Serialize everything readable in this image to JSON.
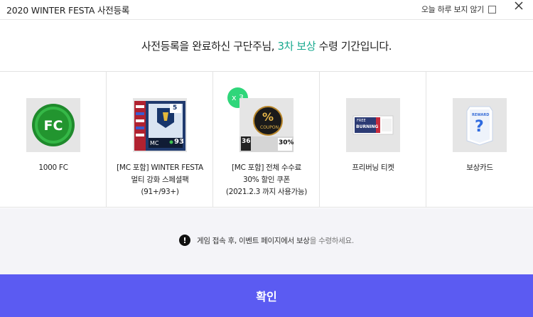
{
  "header": {
    "title": "2020 WINTER FESTA 사전등록",
    "dont_show_label": "오늘 하루 보지 않기"
  },
  "headline": {
    "prefix": "사전등록을 완료하신 구단주님, ",
    "accent": "3차 보상",
    "suffix": " 수령 기간입니다."
  },
  "rewards": [
    {
      "icon": "fc-coin-icon",
      "lines": [
        "1000 FC"
      ]
    },
    {
      "icon": "player-pack-icon",
      "lines": [
        "[MC 포함] WINTER FESTA",
        "멀티 강화 스페셜팩",
        "(91+/93+)"
      ],
      "thumb_text": {
        "level": "5",
        "ovr": "93",
        "pos": "MC"
      }
    },
    {
      "icon": "coupon-icon",
      "badge": "x 3",
      "lines": [
        "[MC 포함] 전체 수수료",
        "30% 할인 쿠폰",
        "(2021.2.3 까지 사용가능)"
      ],
      "thumb_text": {
        "sign": "%",
        "coupon": "COUPON",
        "days": "36",
        "percent": "30%"
      }
    },
    {
      "icon": "burning-ticket-icon",
      "lines": [
        "프리버닝 티켓"
      ],
      "thumb_text": {
        "free": "FREE",
        "burning": "BURNING"
      }
    },
    {
      "icon": "reward-card-icon",
      "lines": [
        "보상카드"
      ],
      "thumb_text": {
        "reward": "REWARD",
        "mark": "?"
      }
    }
  ],
  "notice": {
    "icon_glyph": "!",
    "text_main": "게임 접속 후, 이벤트 페이지에서 보상",
    "text_muted": "을 수령하세요."
  },
  "confirm_label": "확인",
  "colors": {
    "accent": "#19a98f",
    "confirm_bg": "#5b5bf2",
    "badge": "#2fd67a",
    "notice_bg": "#f4f4f8"
  }
}
